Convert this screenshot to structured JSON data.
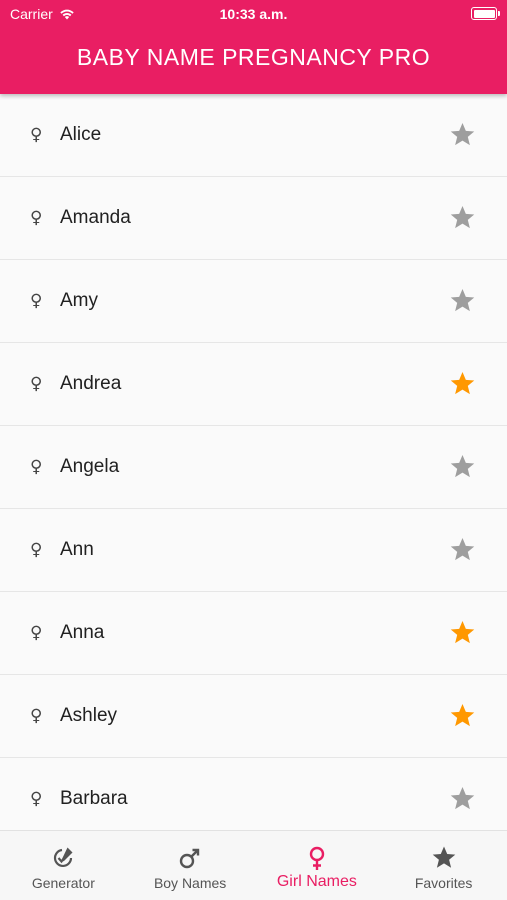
{
  "status_bar": {
    "carrier": "Carrier",
    "time": "10:33 a.m."
  },
  "header": {
    "title": "BABY NAME PREGNANCY PRO"
  },
  "names": [
    {
      "name": "Alice",
      "favorite": false
    },
    {
      "name": "Amanda",
      "favorite": false
    },
    {
      "name": "Amy",
      "favorite": false
    },
    {
      "name": "Andrea",
      "favorite": true
    },
    {
      "name": "Angela",
      "favorite": false
    },
    {
      "name": "Ann",
      "favorite": false
    },
    {
      "name": "Anna",
      "favorite": true
    },
    {
      "name": "Ashley",
      "favorite": true
    },
    {
      "name": "Barbara",
      "favorite": false
    }
  ],
  "gender_symbol": "♀",
  "tabs": [
    {
      "label": "Generator",
      "icon": "generator-icon",
      "active": false
    },
    {
      "label": "Boy Names",
      "icon": "male-icon",
      "active": false
    },
    {
      "label": "Girl Names",
      "icon": "female-icon",
      "active": true
    },
    {
      "label": "Favorites",
      "icon": "star-icon",
      "active": false
    }
  ],
  "colors": {
    "brand": "#e91e63",
    "star_off": "#9e9e9e",
    "star_on": "#ff9800",
    "tab_inactive": "#555555"
  }
}
